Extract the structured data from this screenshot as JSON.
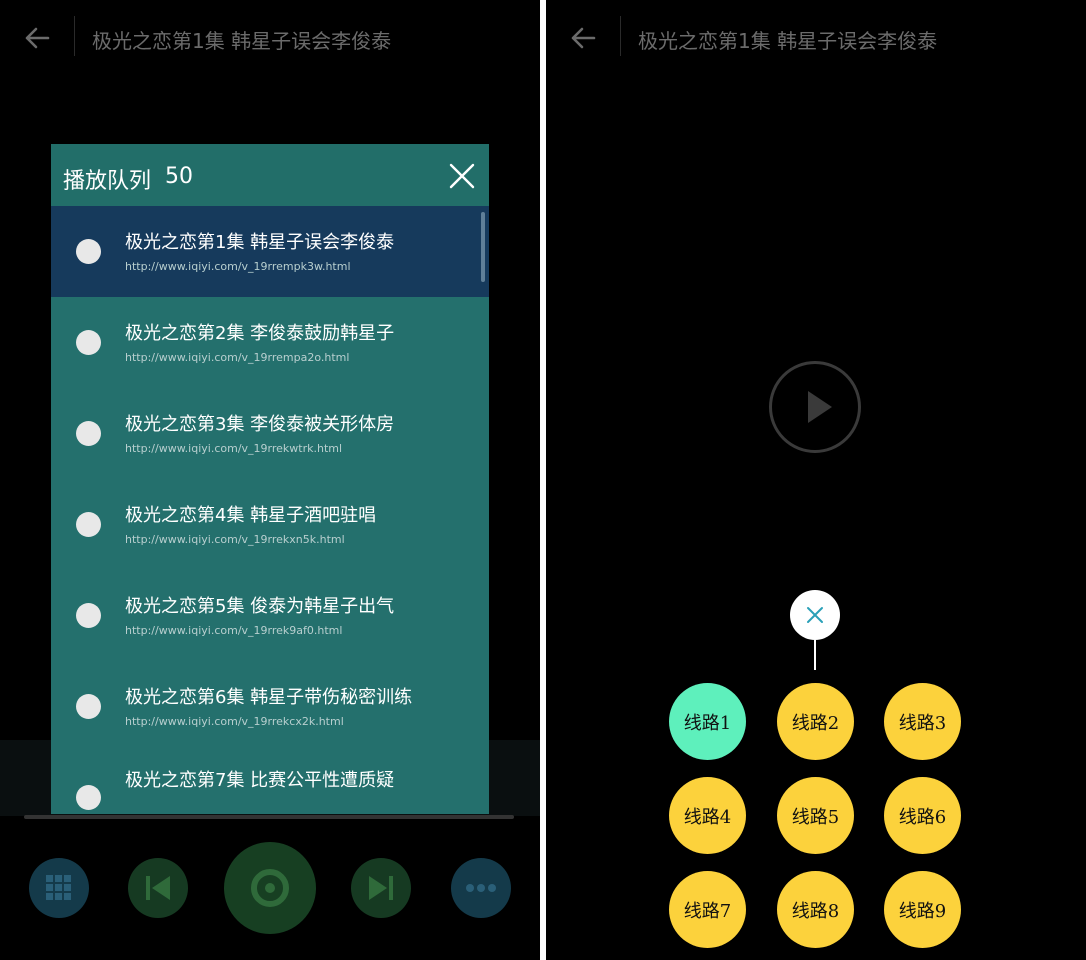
{
  "header": {
    "title": "极光之恋第1集 韩星子误会李俊泰"
  },
  "playlist": {
    "title": "播放队列",
    "count": "50",
    "items": [
      {
        "title": "极光之恋第1集 韩星子误会李俊泰",
        "url": "http://www.iqiyi.com/v_19rrempk3w.html",
        "active": true
      },
      {
        "title": "极光之恋第2集 李俊泰鼓励韩星子",
        "url": "http://www.iqiyi.com/v_19rrempa2o.html"
      },
      {
        "title": "极光之恋第3集 李俊泰被关形体房",
        "url": "http://www.iqiyi.com/v_19rrekwtrk.html"
      },
      {
        "title": "极光之恋第4集 韩星子酒吧驻唱",
        "url": "http://www.iqiyi.com/v_19rrekxn5k.html"
      },
      {
        "title": "极光之恋第5集 俊泰为韩星子出气",
        "url": "http://www.iqiyi.com/v_19rrek9af0.html"
      },
      {
        "title": "极光之恋第6集 韩星子带伤秘密训练",
        "url": "http://www.iqiyi.com/v_19rrekcx2k.html"
      },
      {
        "title": "极光之恋第7集 比赛公平性遭质疑",
        "url": ""
      }
    ]
  },
  "routes": {
    "items": [
      "线路1",
      "线路2",
      "线路3",
      "线路4",
      "线路5",
      "线路6",
      "线路7",
      "线路8",
      "线路9"
    ],
    "active_index": 0
  },
  "colors": {
    "dialog": "#24706d",
    "active_item": "#163a5c",
    "route": "#fcd23c",
    "route_active": "#5ef0bc"
  },
  "icons": {
    "back": "arrow-left-icon",
    "close": "close-icon",
    "play": "play-icon",
    "grid": "grid-icon",
    "prev": "skip-previous-icon",
    "record": "disc-icon",
    "next": "skip-next-icon",
    "more": "more-icon"
  }
}
